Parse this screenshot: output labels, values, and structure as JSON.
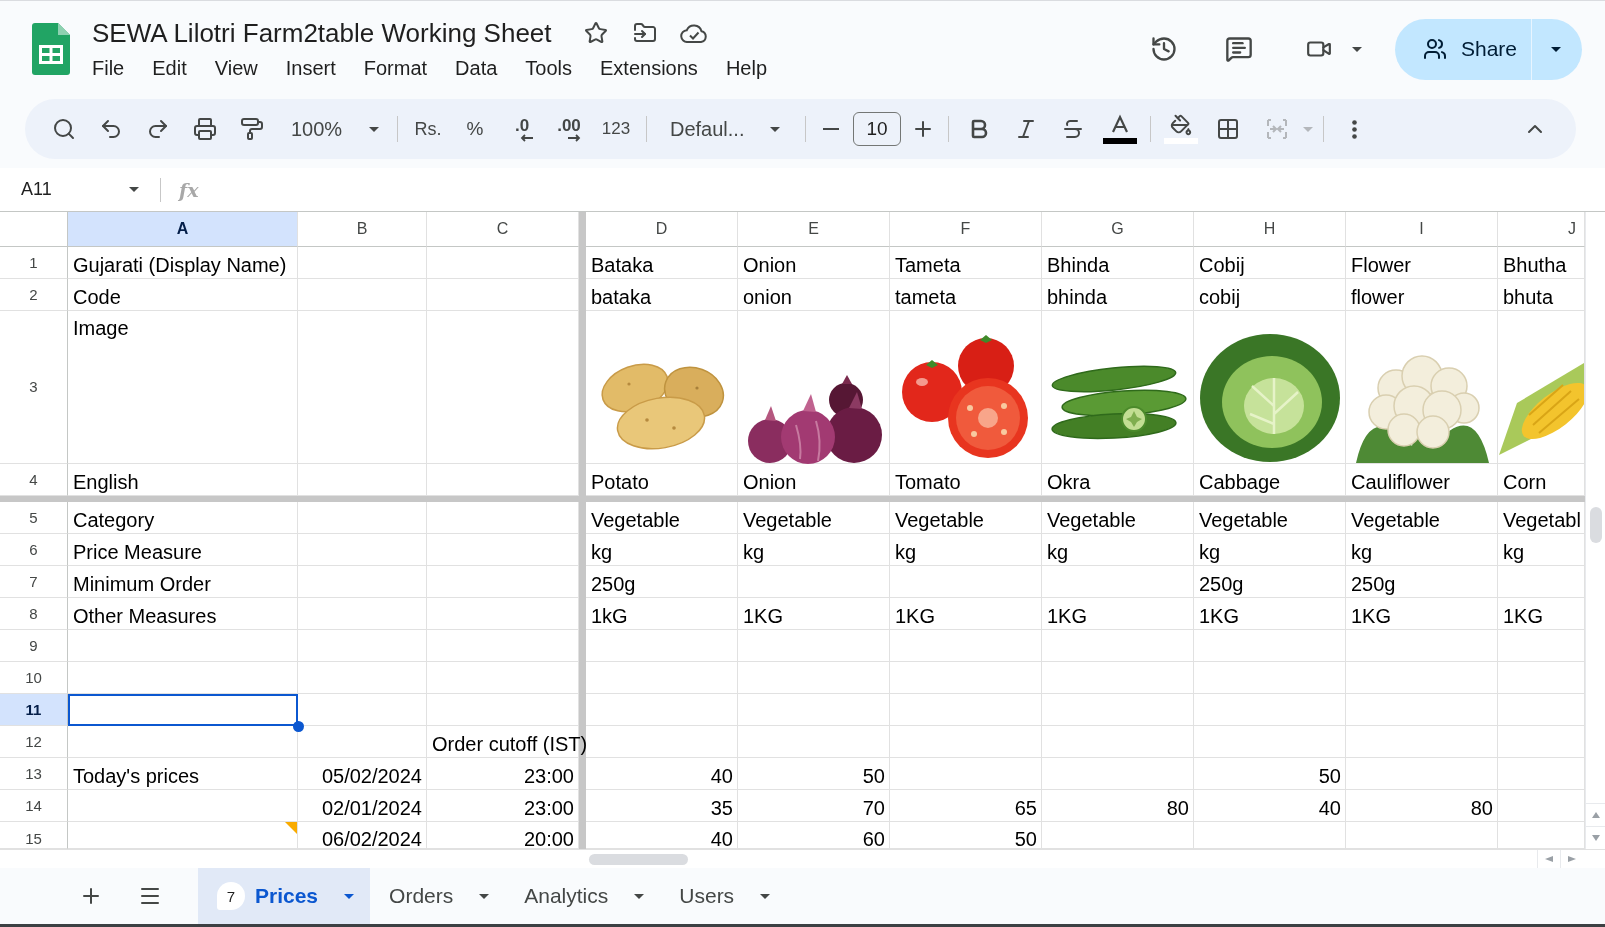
{
  "document": {
    "title": "SEWA Lilotri Farm2table Working Sheet",
    "menu": [
      "File",
      "Edit",
      "View",
      "Insert",
      "Format",
      "Data",
      "Tools",
      "Extensions",
      "Help"
    ],
    "share_label": "Share"
  },
  "toolbar": {
    "zoom": "100%",
    "currency": "Rs.",
    "percent": "%",
    "decrease_decimal": ".0",
    "increase_decimal": ".00",
    "number_format": "123",
    "font": "Defaul...",
    "font_size": "10",
    "merge_cells": {
      "disabled": true
    }
  },
  "formula_bar": {
    "name_box": "A11",
    "function_symbol": "fx"
  },
  "grid": {
    "columns": [
      {
        "label": "A",
        "selected": true
      },
      {
        "label": "B",
        "selected": false
      },
      {
        "label": "C",
        "selected": false
      },
      {
        "label": "D",
        "selected": false
      },
      {
        "label": "E",
        "selected": false
      },
      {
        "label": "F",
        "selected": false
      },
      {
        "label": "G",
        "selected": false
      },
      {
        "label": "H",
        "selected": false
      },
      {
        "label": "I",
        "selected": false
      },
      {
        "label": "J",
        "selected": false
      }
    ],
    "rows": [
      {
        "number": "1",
        "kind": "text",
        "selected": false,
        "cells": [
          "Gujarati (Display Name)",
          null,
          null,
          "Bataka",
          "Onion",
          "Tameta",
          "Bhinda",
          "Cobij",
          "Flower",
          "Bhutha"
        ]
      },
      {
        "number": "2",
        "kind": "text",
        "selected": false,
        "cells": [
          "Code",
          null,
          null,
          "bataka",
          "onion",
          "tameta",
          "bhinda",
          "cobij",
          "flower",
          "bhuta"
        ]
      },
      {
        "number": "3",
        "kind": "image",
        "selected": false,
        "cells": [
          "Image",
          null,
          null,
          {
            "kind": "potato"
          },
          {
            "kind": "onion"
          },
          {
            "kind": "tomato"
          },
          {
            "kind": "okra"
          },
          {
            "kind": "cabbage"
          },
          {
            "kind": "cauliflower"
          },
          {
            "kind": "corn"
          }
        ]
      },
      {
        "number": "4",
        "kind": "text",
        "selected": false,
        "cells": [
          "English",
          null,
          null,
          "Potato",
          "Onion",
          "Tomato",
          "Okra",
          "Cabbage",
          "Cauliflower",
          "Corn"
        ]
      },
      {
        "number": "5",
        "kind": "text",
        "selected": false,
        "cells": [
          "Category",
          null,
          null,
          "Vegetable",
          "Vegetable",
          "Vegetable",
          "Vegetable",
          "Vegetable",
          "Vegetable",
          "Vegetabl"
        ]
      },
      {
        "number": "6",
        "kind": "text",
        "selected": false,
        "cells": [
          "Price Measure",
          null,
          null,
          "kg",
          "kg",
          "kg",
          "kg",
          "kg",
          "kg",
          "kg"
        ]
      },
      {
        "number": "7",
        "kind": "text",
        "selected": false,
        "cells": [
          "Minimum Order",
          null,
          null,
          "250g",
          null,
          null,
          null,
          "250g",
          "250g"
        ]
      },
      {
        "number": "8",
        "kind": "text",
        "selected": false,
        "cells": [
          "Other Measures",
          null,
          null,
          "1kG",
          "1KG",
          "1KG",
          "1KG",
          "1KG",
          "1KG",
          "1KG"
        ]
      },
      {
        "number": "9",
        "kind": "text",
        "selected": false
      },
      {
        "number": "10",
        "kind": "text",
        "selected": false
      },
      {
        "number": "11",
        "kind": "text",
        "selected": true
      },
      {
        "number": "12",
        "kind": "text",
        "selected": false,
        "cells": [
          null,
          null,
          "Order cutoff (IST)"
        ]
      },
      {
        "number": "13",
        "kind": "values",
        "selected": false,
        "cells": [
          "Today's prices",
          "05/02/2024",
          "23:00",
          "40",
          "50",
          null,
          null,
          "50"
        ]
      },
      {
        "number": "14",
        "kind": "values",
        "selected": false,
        "cells": [
          null,
          "02/01/2024",
          "23:00",
          "35",
          "70",
          "65",
          "80",
          "40",
          "80"
        ]
      },
      {
        "number": "15",
        "kind": "values",
        "selected": false,
        "cells": [
          {
            "has_comment": true
          },
          "06/02/2024",
          "20:00",
          "40",
          "60",
          "50"
        ]
      }
    ]
  },
  "sheet_tabs": [
    {
      "label": "Prices",
      "badge": "7",
      "selected": true
    },
    {
      "label": "Orders",
      "selected": false
    },
    {
      "label": "Analytics",
      "selected": false
    },
    {
      "label": "Users",
      "selected": false
    }
  ]
}
